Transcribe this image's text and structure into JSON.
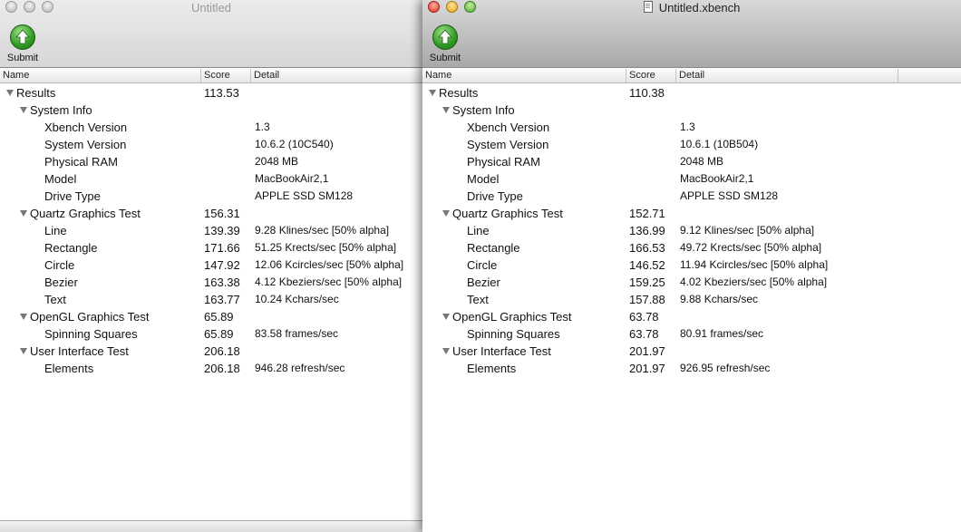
{
  "left": {
    "title": "Untitled",
    "submit_label": "Submit",
    "columns": [
      "Name",
      "Score",
      "Detail"
    ],
    "rows": [
      {
        "name": "Results",
        "score": "113.53",
        "detail": ""
      },
      {
        "name": "System Info",
        "score": "",
        "detail": ""
      },
      {
        "name": "Xbench Version",
        "score": "",
        "detail": "1.3"
      },
      {
        "name": "System Version",
        "score": "",
        "detail": "10.6.2 (10C540)"
      },
      {
        "name": "Physical RAM",
        "score": "",
        "detail": "2048 MB"
      },
      {
        "name": "Model",
        "score": "",
        "detail": "MacBookAir2,1"
      },
      {
        "name": "Drive Type",
        "score": "",
        "detail": "APPLE SSD SM128"
      },
      {
        "name": "Quartz Graphics Test",
        "score": "156.31",
        "detail": ""
      },
      {
        "name": "Line",
        "score": "139.39",
        "detail": "9.28 Klines/sec [50% alpha]"
      },
      {
        "name": "Rectangle",
        "score": "171.66",
        "detail": "51.25 Krects/sec [50% alpha]"
      },
      {
        "name": "Circle",
        "score": "147.92",
        "detail": "12.06 Kcircles/sec [50% alpha]"
      },
      {
        "name": "Bezier",
        "score": "163.38",
        "detail": "4.12 Kbeziers/sec [50% alpha]"
      },
      {
        "name": "Text",
        "score": "163.77",
        "detail": "10.24 Kchars/sec"
      },
      {
        "name": "OpenGL Graphics Test",
        "score": "65.89",
        "detail": ""
      },
      {
        "name": "Spinning Squares",
        "score": "65.89",
        "detail": "83.58 frames/sec"
      },
      {
        "name": "User Interface Test",
        "score": "206.18",
        "detail": ""
      },
      {
        "name": "Elements",
        "score": "206.18",
        "detail": "946.28 refresh/sec"
      }
    ]
  },
  "right": {
    "title": "Untitled.xbench",
    "submit_label": "Submit",
    "columns": [
      "Name",
      "Score",
      "Detail"
    ],
    "rows": [
      {
        "name": "Results",
        "score": "110.38",
        "detail": ""
      },
      {
        "name": "System Info",
        "score": "",
        "detail": ""
      },
      {
        "name": "Xbench Version",
        "score": "",
        "detail": "1.3"
      },
      {
        "name": "System Version",
        "score": "",
        "detail": "10.6.1 (10B504)"
      },
      {
        "name": "Physical RAM",
        "score": "",
        "detail": "2048 MB"
      },
      {
        "name": "Model",
        "score": "",
        "detail": "MacBookAir2,1"
      },
      {
        "name": "Drive Type",
        "score": "",
        "detail": "APPLE SSD SM128"
      },
      {
        "name": "Quartz Graphics Test",
        "score": "152.71",
        "detail": ""
      },
      {
        "name": "Line",
        "score": "136.99",
        "detail": "9.12 Klines/sec [50% alpha]"
      },
      {
        "name": "Rectangle",
        "score": "166.53",
        "detail": "49.72 Krects/sec [50% alpha]"
      },
      {
        "name": "Circle",
        "score": "146.52",
        "detail": "11.94 Kcircles/sec [50% alpha]"
      },
      {
        "name": "Bezier",
        "score": "159.25",
        "detail": "4.02 Kbeziers/sec [50% alpha]"
      },
      {
        "name": "Text",
        "score": "157.88",
        "detail": "9.88 Kchars/sec"
      },
      {
        "name": "OpenGL Graphics Test",
        "score": "63.78",
        "detail": ""
      },
      {
        "name": "Spinning Squares",
        "score": "63.78",
        "detail": "80.91 frames/sec"
      },
      {
        "name": "User Interface Test",
        "score": "201.97",
        "detail": ""
      },
      {
        "name": "Elements",
        "score": "201.97",
        "detail": "926.95 refresh/sec"
      }
    ]
  }
}
